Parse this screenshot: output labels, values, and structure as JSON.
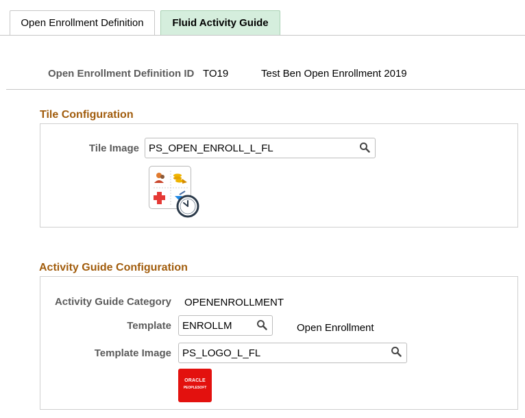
{
  "tabs": [
    {
      "label": "Open Enrollment Definition",
      "active": false
    },
    {
      "label": "Fluid Activity Guide",
      "active": true
    }
  ],
  "header": {
    "id_label": "Open Enrollment Definition ID",
    "id_value": "TO19",
    "id_description": "Test Ben Open Enrollment 2019"
  },
  "tile_configuration": {
    "title": "Tile Configuration",
    "tile_image_label": "Tile Image",
    "tile_image_value": "PS_OPEN_ENROLL_L_FL",
    "tile_image_icon": "benefits-tile-icon"
  },
  "activity_guide_configuration": {
    "title": "Activity Guide Configuration",
    "category_label": "Activity Guide Category",
    "category_value": "OPENENROLLMENT",
    "template_label": "Template",
    "template_value": "ENROLLM",
    "template_description": "Open Enrollment",
    "template_image_label": "Template Image",
    "template_image_value": "PS_LOGO_L_FL",
    "logo": {
      "line1": "ORACLE",
      "line2": "PEOPLESOFT"
    }
  },
  "colors": {
    "section_title": "#a15c0c",
    "active_tab": "#d5eedd",
    "logo_red": "#e3110e"
  }
}
